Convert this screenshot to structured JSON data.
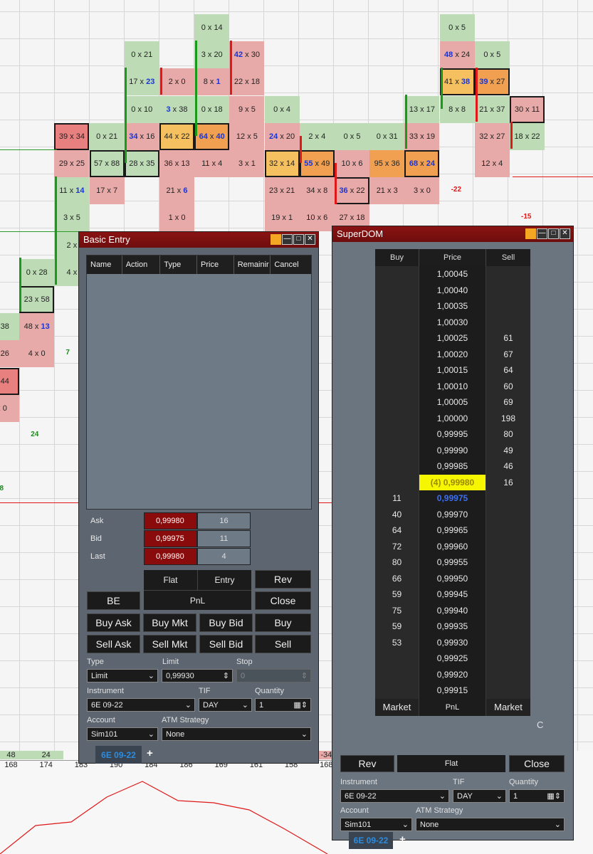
{
  "chart": {
    "cells": [
      {
        "t": "0 x 14",
        "k": "g",
        "c": 6,
        "r": 0
      },
      {
        "t": "0 x 5",
        "k": "g",
        "c": 13,
        "r": 0
      },
      {
        "t": "0 x 21",
        "k": "g",
        "c": 4,
        "r": 1
      },
      {
        "t": "3 x 20",
        "k": "g",
        "c": 6,
        "r": 1
      },
      {
        "t": "42 x 30",
        "k": "r",
        "c": 7,
        "r": 1,
        "bl": "42"
      },
      {
        "t": "48 x 24",
        "k": "r",
        "c": 13,
        "r": 1,
        "bl": "48"
      },
      {
        "t": "0 x 5",
        "k": "g",
        "c": 14,
        "r": 1
      },
      {
        "t": "17 x 23",
        "k": "g",
        "c": 4,
        "r": 2,
        "br": "23"
      },
      {
        "t": "2 x 0",
        "k": "r",
        "c": 5,
        "r": 2
      },
      {
        "t": "8 x 1",
        "k": "r",
        "c": 6,
        "r": 2,
        "br": "1"
      },
      {
        "t": "22 x 18",
        "k": "r",
        "c": 7,
        "r": 2
      },
      {
        "t": "41 x 38",
        "k": "y",
        "c": 13,
        "r": 2,
        "box": true,
        "br": "38"
      },
      {
        "t": "39 x 27",
        "k": "o",
        "c": 14,
        "r": 2,
        "box": true,
        "bl": "39"
      },
      {
        "t": "0 x 10",
        "k": "g",
        "c": 4,
        "r": 3
      },
      {
        "t": "3 x 38",
        "k": "g",
        "c": 5,
        "r": 3,
        "bl": "3"
      },
      {
        "t": "0 x 18",
        "k": "g",
        "c": 6,
        "r": 3
      },
      {
        "t": "9 x 5",
        "k": "r",
        "c": 7,
        "r": 3
      },
      {
        "t": "0 x 4",
        "k": "g",
        "c": 8,
        "r": 3
      },
      {
        "t": "13 x 17",
        "k": "g",
        "c": 12,
        "r": 3
      },
      {
        "t": "8 x 8",
        "k": "g",
        "c": 13,
        "r": 3
      },
      {
        "t": "21 x 37",
        "k": "g",
        "c": 14,
        "r": 3
      },
      {
        "t": "30 x 11",
        "k": "r",
        "c": 15,
        "r": 3,
        "box": true
      },
      {
        "t": "39 x 34",
        "k": "rd",
        "c": 2,
        "r": 4,
        "box": true
      },
      {
        "t": "0 x 21",
        "k": "g",
        "c": 3,
        "r": 4
      },
      {
        "t": "34 x 16",
        "k": "r",
        "c": 4,
        "r": 4,
        "bl": "34"
      },
      {
        "t": "44 x 22",
        "k": "y",
        "c": 5,
        "r": 4,
        "box": true
      },
      {
        "t": "64 x 40",
        "k": "o",
        "c": 6,
        "r": 4,
        "box": true,
        "bl": "64",
        "br": "40"
      },
      {
        "t": "12 x 5",
        "k": "r",
        "c": 7,
        "r": 4
      },
      {
        "t": "24 x 20",
        "k": "r",
        "c": 8,
        "r": 4,
        "bl": "24"
      },
      {
        "t": "2 x 4",
        "k": "g",
        "c": 9,
        "r": 4
      },
      {
        "t": "0 x 5",
        "k": "g",
        "c": 10,
        "r": 4
      },
      {
        "t": "0 x 31",
        "k": "g",
        "c": 11,
        "r": 4
      },
      {
        "t": "33 x 19",
        "k": "r",
        "c": 12,
        "r": 4
      },
      {
        "t": "32 x 27",
        "k": "r",
        "c": 14,
        "r": 4
      },
      {
        "t": "18 x 22",
        "k": "g",
        "c": 15,
        "r": 4
      },
      {
        "t": "29 x 25",
        "k": "r",
        "c": 2,
        "r": 5
      },
      {
        "t": "57 x 88",
        "k": "g",
        "c": 3,
        "r": 5,
        "box": true
      },
      {
        "t": "28 x 35",
        "k": "g",
        "c": 4,
        "r": 5,
        "box": true
      },
      {
        "t": "36 x 13",
        "k": "r",
        "c": 5,
        "r": 5
      },
      {
        "t": "11 x 4",
        "k": "r",
        "c": 6,
        "r": 5
      },
      {
        "t": "3 x 1",
        "k": "r",
        "c": 7,
        "r": 5
      },
      {
        "t": "32 x 14",
        "k": "y",
        "c": 8,
        "r": 5,
        "box": true
      },
      {
        "t": "55 x 49",
        "k": "o",
        "c": 9,
        "r": 5,
        "box": true,
        "bl": "55"
      },
      {
        "t": "10 x 6",
        "k": "r",
        "c": 10,
        "r": 5
      },
      {
        "t": "95 x 36",
        "k": "o",
        "c": 11,
        "r": 5
      },
      {
        "t": "68 x 24",
        "k": "o",
        "c": 12,
        "r": 5,
        "box": true,
        "bl": "68",
        "br": "24"
      },
      {
        "t": "12 x 4",
        "k": "r",
        "c": 14,
        "r": 5
      },
      {
        "t": "11 x 14",
        "k": "g",
        "c": 2,
        "r": 6,
        "br": "14"
      },
      {
        "t": "17 x 7",
        "k": "r",
        "c": 3,
        "r": 6
      },
      {
        "t": "21 x 6",
        "k": "r",
        "c": 5,
        "r": 6,
        "br": "6"
      },
      {
        "t": "23 x 21",
        "k": "r",
        "c": 8,
        "r": 6
      },
      {
        "t": "34 x 8",
        "k": "r",
        "c": 9,
        "r": 6
      },
      {
        "t": "36 x 22",
        "k": "r",
        "c": 10,
        "r": 6,
        "box": true,
        "bl": "36"
      },
      {
        "t": "21 x 3",
        "k": "r",
        "c": 11,
        "r": 6
      },
      {
        "t": "3 x 0",
        "k": "r",
        "c": 12,
        "r": 6
      },
      {
        "t": "3 x 5",
        "k": "g",
        "c": 2,
        "r": 7
      },
      {
        "t": "1 x 0",
        "k": "r",
        "c": 5,
        "r": 7
      },
      {
        "t": "19 x 1",
        "k": "r",
        "c": 8,
        "r": 7
      },
      {
        "t": "10 x 6",
        "k": "r",
        "c": 9,
        "r": 7
      },
      {
        "t": "27 x 18",
        "k": "r",
        "c": 10,
        "r": 7
      },
      {
        "t": "2 x",
        "k": "g",
        "c": 2,
        "r": 8
      },
      {
        "t": "0 x 28",
        "k": "g",
        "c": 1,
        "r": 9
      },
      {
        "t": "4 x",
        "k": "g",
        "c": 2,
        "r": 9
      },
      {
        "t": "23 x 58",
        "k": "g",
        "c": 1,
        "r": 10,
        "box": true
      },
      {
        "t": "x 38",
        "k": "g",
        "c": 0,
        "r": 11,
        "br": "38"
      },
      {
        "t": "48 x 13",
        "k": "r",
        "c": 1,
        "r": 11,
        "br": "13"
      },
      {
        "t": "x 26",
        "k": "r",
        "c": 0,
        "r": 12
      },
      {
        "t": "4 x 0",
        "k": "r",
        "c": 1,
        "r": 12
      },
      {
        "t": "x 44",
        "k": "rd",
        "c": 0,
        "r": 13,
        "box": true,
        "br": "44"
      },
      {
        "t": "x 0",
        "k": "r",
        "c": 0,
        "r": 14
      }
    ],
    "deltas": [
      {
        "t": "-22",
        "k": "neg",
        "c": 13,
        "r": 6
      },
      {
        "t": "-15",
        "k": "neg",
        "c": 15,
        "r": 7
      },
      {
        "t": "7",
        "k": "pos",
        "c": 2,
        "r": 12
      },
      {
        "t": "24",
        "k": "pos",
        "c": 1,
        "r": 15
      },
      {
        "t": "48",
        "k": "pos",
        "c": 0,
        "r": 17
      },
      {
        "t": "34",
        "k": "neg",
        "c": 9,
        "r": 10
      }
    ],
    "lower_top": [
      "48",
      "24",
      "",
      "",
      "",
      "",
      "",
      "",
      "",
      "-34"
    ],
    "lower_vals": [
      "168",
      "174",
      "183",
      "190",
      "184",
      "186",
      "169",
      "161",
      "158",
      "168"
    ],
    "line_points": [
      [
        0,
        1200
      ],
      [
        50,
        1160
      ],
      [
        100,
        1155
      ],
      [
        150,
        1120
      ],
      [
        200,
        1098
      ],
      [
        250,
        1125
      ],
      [
        300,
        1128
      ],
      [
        350,
        1138
      ],
      [
        400,
        1165
      ],
      [
        460,
        1200
      ]
    ]
  },
  "basic_entry": {
    "title": "Basic Entry",
    "columns": [
      "Name",
      "Action",
      "Type",
      "Price",
      "Remainir",
      "Cancel"
    ],
    "quotes": [
      {
        "label": "Ask",
        "price": "0,99980",
        "size": "16"
      },
      {
        "label": "Bid",
        "price": "0,99975",
        "size": "11"
      },
      {
        "label": "Last",
        "price": "0,99980",
        "size": "4"
      }
    ],
    "flat_label": "Flat",
    "entry_label": "Entry",
    "pnl_label": "PnL",
    "buttons": {
      "rev": "Rev",
      "be": "BE",
      "close": "Close",
      "buy_ask": "Buy Ask",
      "buy_mkt": "Buy Mkt",
      "buy_bid": "Buy Bid",
      "buy": "Buy",
      "sell_ask": "Sell Ask",
      "sell_mkt": "Sell Mkt",
      "sell_bid": "Sell Bid",
      "sell": "Sell"
    },
    "labels": {
      "type": "Type",
      "limit": "Limit",
      "stop": "Stop",
      "instrument": "Instrument",
      "tif": "TIF",
      "quantity": "Quantity",
      "account": "Account",
      "atm": "ATM Strategy"
    },
    "values": {
      "type": "Limit",
      "limit": "0,99930",
      "stop": "0",
      "instrument": "6E 09-22",
      "tif": "DAY",
      "quantity": "1",
      "account": "Sim101",
      "atm": "None"
    },
    "tab": "6E 09-22"
  },
  "superdom": {
    "title": "SuperDOM",
    "headers": {
      "buy": "Buy",
      "price": "Price",
      "sell": "Sell"
    },
    "rows": [
      {
        "p": "1,00045",
        "b": "",
        "s": ""
      },
      {
        "p": "1,00040",
        "b": "",
        "s": ""
      },
      {
        "p": "1,00035",
        "b": "",
        "s": ""
      },
      {
        "p": "1,00030",
        "b": "",
        "s": ""
      },
      {
        "p": "1,00025",
        "b": "",
        "s": "61"
      },
      {
        "p": "1,00020",
        "b": "",
        "s": "67"
      },
      {
        "p": "1,00015",
        "b": "",
        "s": "64"
      },
      {
        "p": "1,00010",
        "b": "",
        "s": "60"
      },
      {
        "p": "1,00005",
        "b": "",
        "s": "69"
      },
      {
        "p": "1,00000",
        "b": "",
        "s": "198"
      },
      {
        "p": "0,99995",
        "b": "",
        "s": "80"
      },
      {
        "p": "0,99990",
        "b": "",
        "s": "49"
      },
      {
        "p": "0,99985",
        "b": "",
        "s": "46"
      },
      {
        "p": "(4) 0,99980",
        "b": "",
        "s": "16",
        "cur": true
      },
      {
        "p": "0,99975",
        "b": "11",
        "s": "",
        "bid": true
      },
      {
        "p": "0,99970",
        "b": "40",
        "s": ""
      },
      {
        "p": "0,99965",
        "b": "64",
        "s": ""
      },
      {
        "p": "0,99960",
        "b": "72",
        "s": ""
      },
      {
        "p": "0,99955",
        "b": "80",
        "s": ""
      },
      {
        "p": "0,99950",
        "b": "66",
        "s": ""
      },
      {
        "p": "0,99945",
        "b": "59",
        "s": ""
      },
      {
        "p": "0,99940",
        "b": "75",
        "s": ""
      },
      {
        "p": "0,99935",
        "b": "59",
        "s": ""
      },
      {
        "p": "0,99930",
        "b": "53",
        "s": ""
      },
      {
        "p": "0,99925",
        "b": "",
        "s": ""
      },
      {
        "p": "0,99920",
        "b": "",
        "s": ""
      },
      {
        "p": "0,99915",
        "b": "",
        "s": ""
      }
    ],
    "market_left": "Market",
    "pnl": "PnL",
    "market_right": "Market",
    "c_label": "C",
    "rev": "Rev",
    "flat": "Flat",
    "close": "Close",
    "labels": {
      "instrument": "Instrument",
      "tif": "TIF",
      "quantity": "Quantity",
      "account": "Account",
      "atm": "ATM Strategy"
    },
    "values": {
      "instrument": "6E 09-22",
      "tif": "DAY",
      "quantity": "1",
      "account": "Sim101",
      "atm": "None"
    },
    "tab": "6E 09-22"
  },
  "colors": {
    "title_bar": "#8a1313",
    "green_cell": "#bddcb6",
    "red_cell": "#e8aaa8",
    "orange_cell": "#f0a050",
    "current_price": "#f6f600"
  }
}
